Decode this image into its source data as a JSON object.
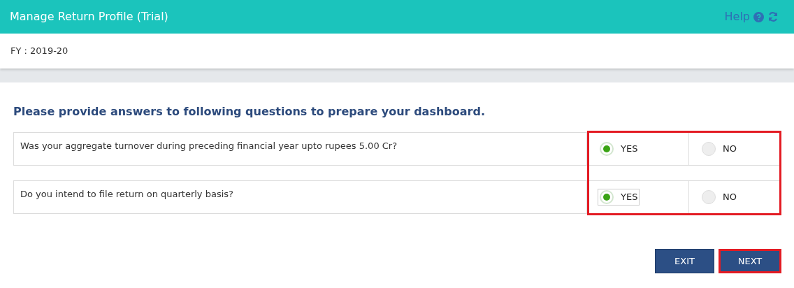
{
  "header": {
    "title": "Manage Return Profile (Trial)",
    "help": "Help"
  },
  "fy": "FY : 2019-20",
  "heading": "Please provide answers to following questions to prepare your dashboard.",
  "answers_highlighted": true,
  "questions": [
    {
      "text": "Was your aggregate turnover during preceding financial year upto rupees 5.00 Cr?",
      "options": [
        {
          "label": "YES",
          "selected": true,
          "focused": false
        },
        {
          "label": "NO",
          "selected": false,
          "focused": false
        }
      ]
    },
    {
      "text": "Do you intend to file return on quarterly basis?",
      "options": [
        {
          "label": "YES",
          "selected": true,
          "focused": true
        },
        {
          "label": "NO",
          "selected": false,
          "focused": false
        }
      ]
    }
  ],
  "buttons": [
    {
      "label": "EXIT",
      "highlighted": false
    },
    {
      "label": "NEXT",
      "highlighted": true
    }
  ]
}
